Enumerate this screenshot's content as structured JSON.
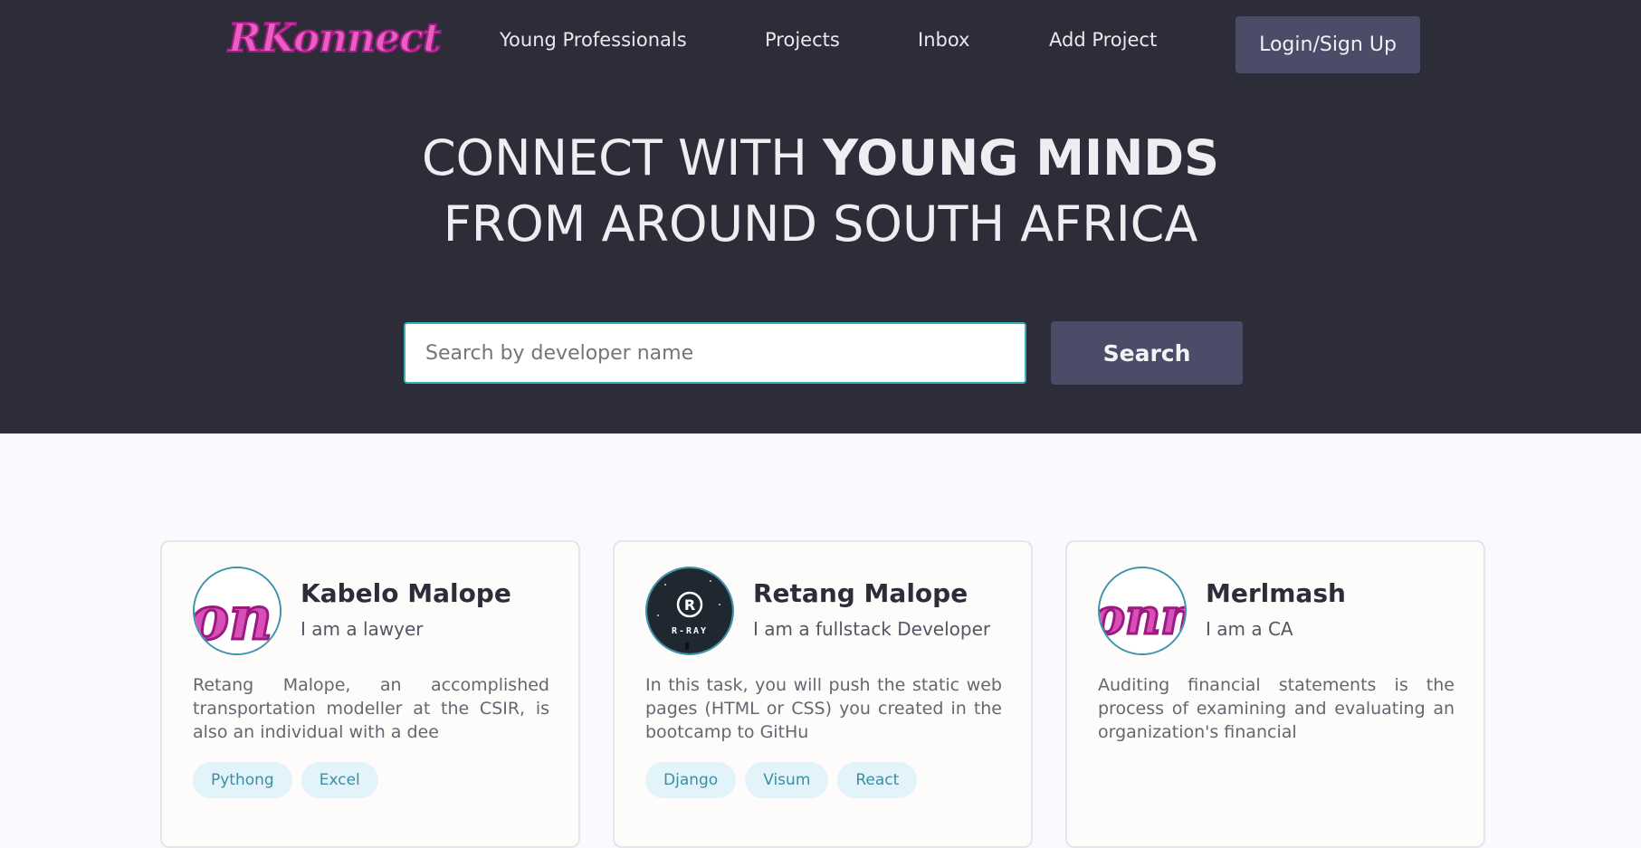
{
  "header": {
    "logo_text": "RKonnect",
    "nav": [
      {
        "label": "Young Professionals"
      },
      {
        "label": "Projects"
      },
      {
        "label": "Inbox"
      },
      {
        "label": "Add Project"
      }
    ],
    "login_label": "Login/Sign Up"
  },
  "hero": {
    "headline_light": "CONNECT WITH ",
    "headline_bold": "YOUNG MINDS",
    "headline_line2": "FROM AROUND SOUTH AFRICA"
  },
  "search": {
    "placeholder": "Search by developer name",
    "value": "",
    "button_label": "Search"
  },
  "profiles": [
    {
      "name": "Kabelo Malope",
      "role": "I am a lawyer",
      "description": "Retang Malope, an accomplished transportation modeller at the CSIR, is also an individual with a dee",
      "avatar_text": "on",
      "skills": [
        "Pythong",
        "Excel"
      ]
    },
    {
      "name": "Retang Malope",
      "role": "I am a fullstack Developer",
      "description": "In this task, you will push the static web pages (HTML or CSS) you created in the bootcamp to GitHu",
      "avatar_text": "R-RAY",
      "skills": [
        "Django",
        "Visum",
        "React"
      ]
    },
    {
      "name": "Merlmash",
      "role": "I am a CA",
      "description": "Auditing financial statements is the process of examining and evaluating an organization's financial",
      "avatar_text": "onn",
      "skills": []
    }
  ],
  "colors": {
    "hero_bg": "#2d2d39",
    "button_bg": "#4a4c68",
    "accent": "#3bb0b7",
    "logo_pink": "#e85fc1",
    "tag_bg": "#e2f3fa",
    "tag_text": "#3b8ea6"
  }
}
